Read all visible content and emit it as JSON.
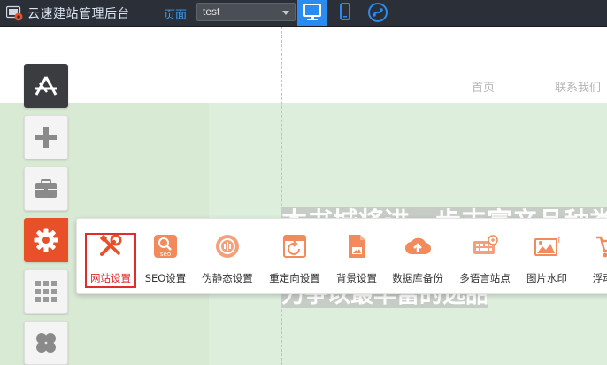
{
  "app": {
    "title": "云速建站管理后台",
    "page_label": "页面",
    "page_select_value": "test"
  },
  "devices": {
    "desktop": "desktop-icon",
    "mobile": "mobile-icon",
    "app": "mini-program-icon"
  },
  "site_nav": {
    "home": "首页",
    "contact": "联系我们"
  },
  "banner": {
    "line1": "本书城将进一步丰富产品种类",
    "line2": "力争以最丰富的选品"
  },
  "settings_panel": {
    "items": [
      {
        "label": "网站设置",
        "icon": "wrench-icon",
        "active": true
      },
      {
        "label": "SEO设置",
        "icon": "seo-icon"
      },
      {
        "label": "伪静态设置",
        "icon": "pseudo-static-icon"
      },
      {
        "label": "重定向设置",
        "icon": "redirect-icon"
      },
      {
        "label": "背景设置",
        "icon": "background-image-icon"
      },
      {
        "label": "数据库备份",
        "icon": "cloud-upload-icon"
      },
      {
        "label": "多语言站点",
        "icon": "keyboard-language-icon"
      },
      {
        "label": "图片水印",
        "icon": "image-watermark-icon"
      },
      {
        "label": "浮动购",
        "icon": "cart-icon"
      }
    ]
  },
  "colors": {
    "accent": "#e8502a",
    "primary_blue": "#2a8cf0",
    "topbar": "#2b2f37",
    "active_border": "#e02c2c"
  }
}
